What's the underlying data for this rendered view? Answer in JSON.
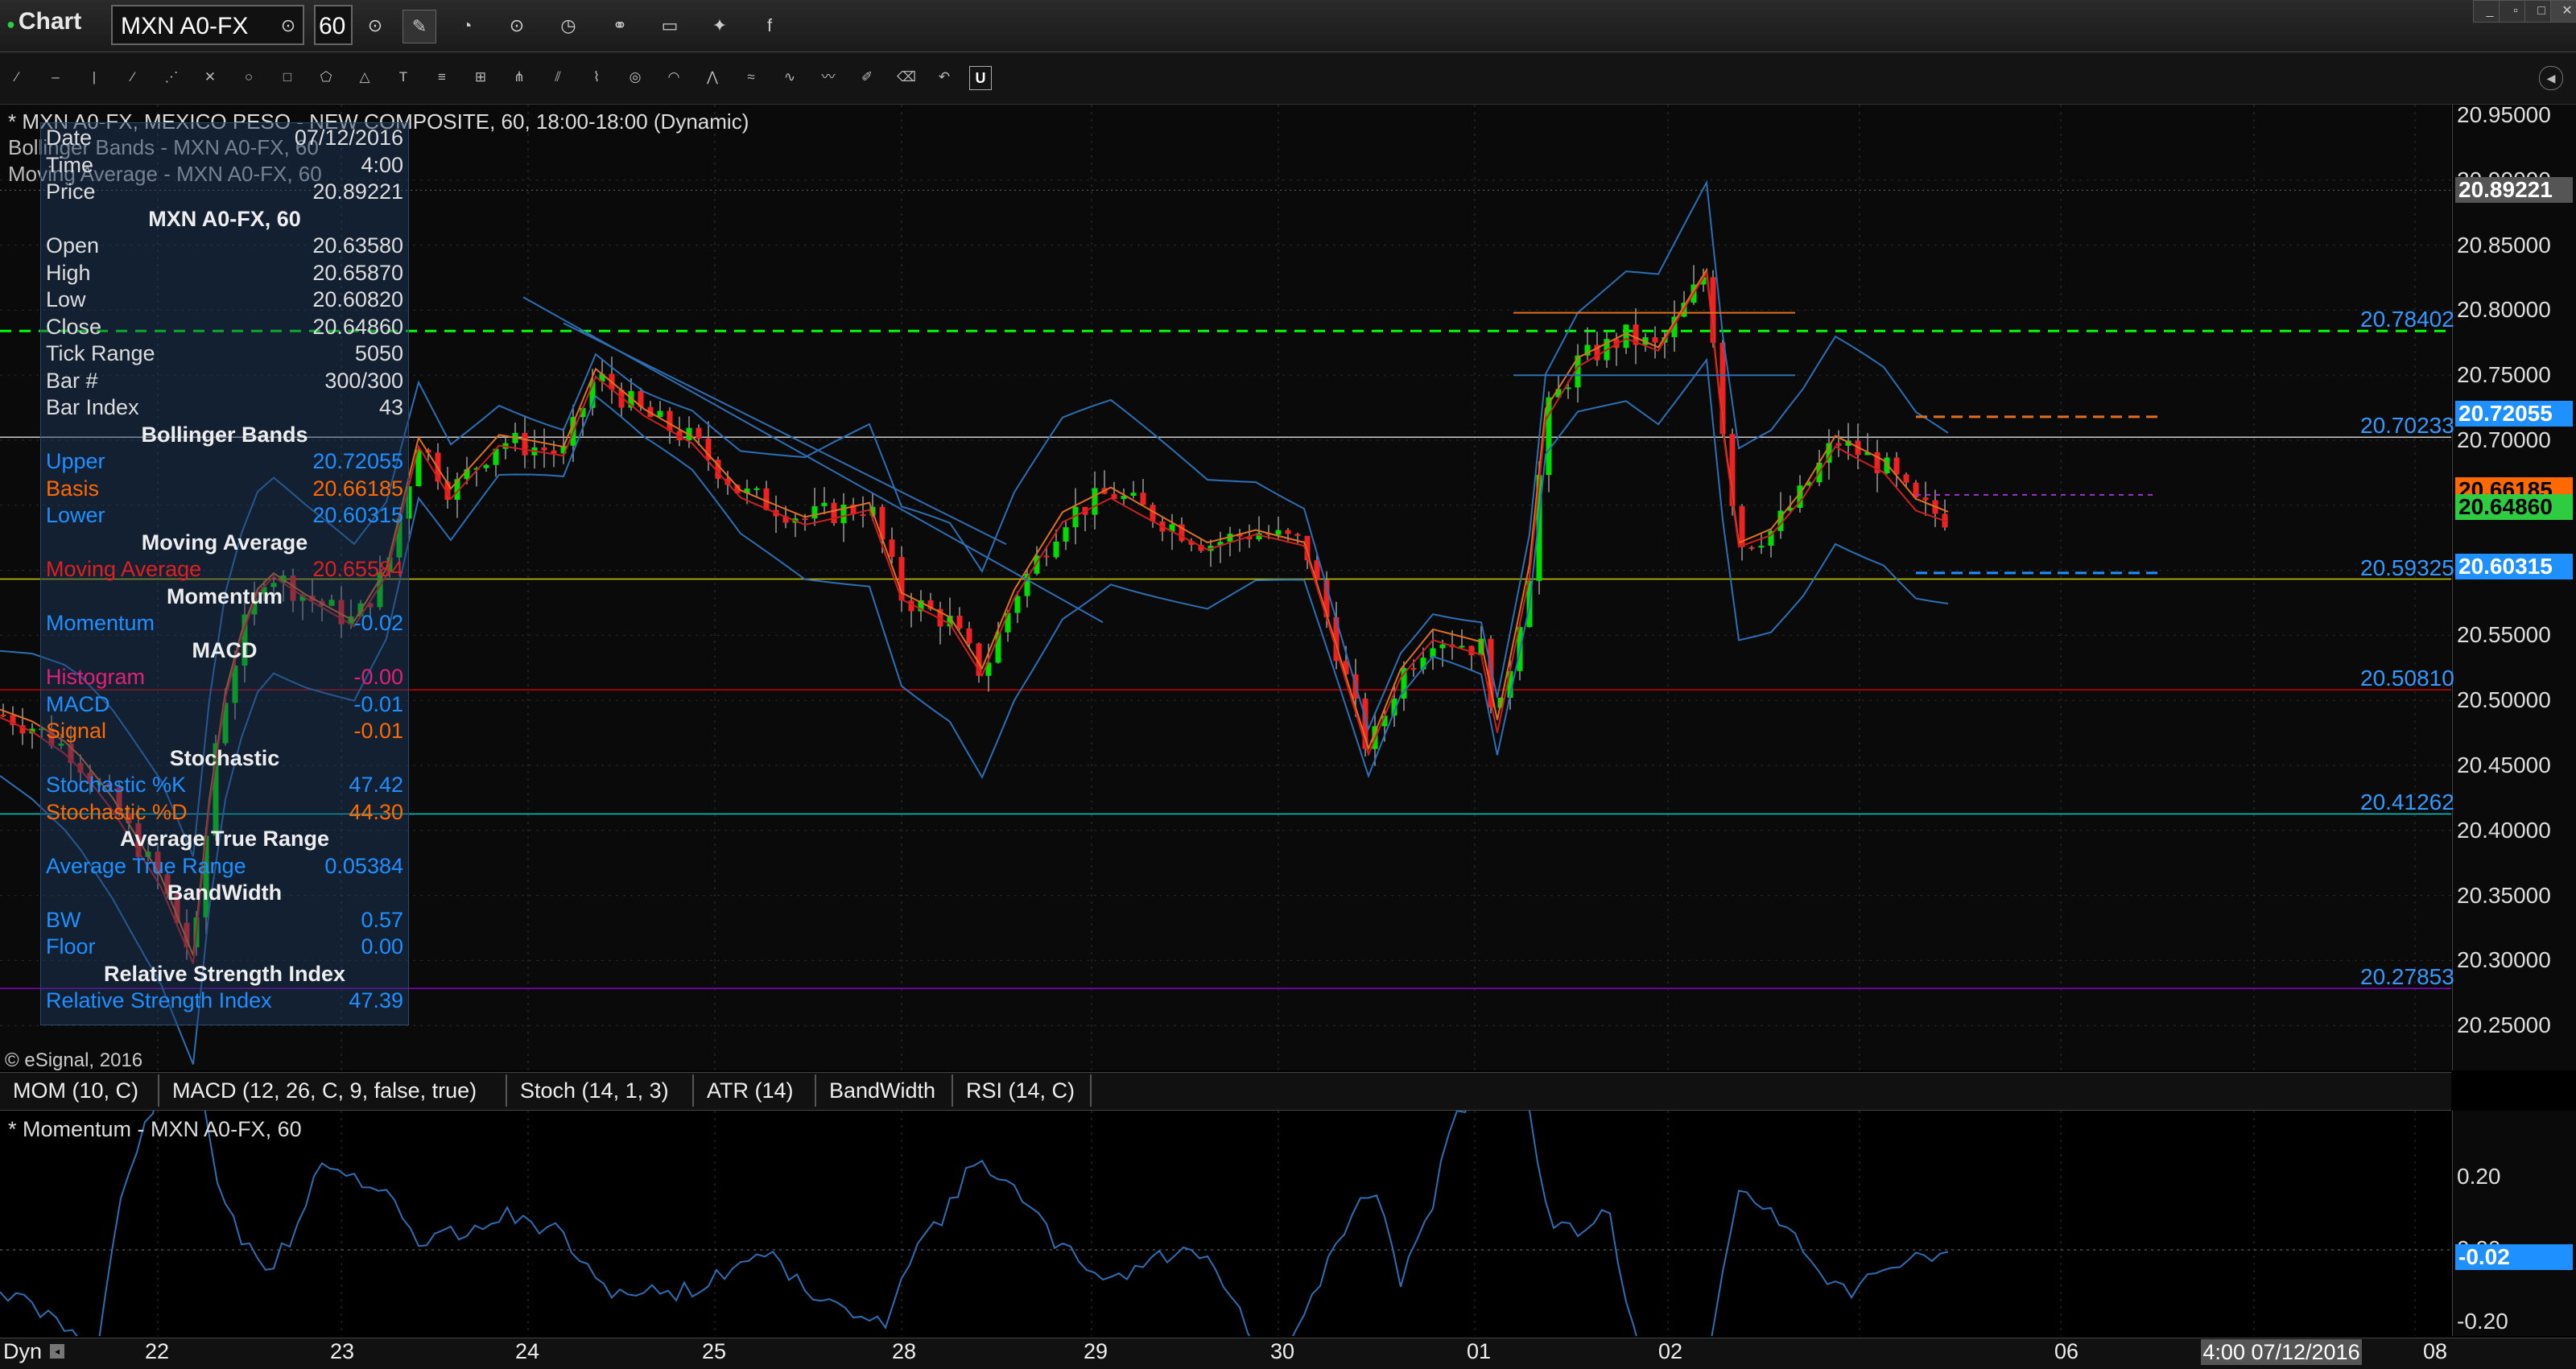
{
  "window": {
    "title": "Chart",
    "symbol": "MXN A0-FX",
    "interval": "60",
    "controls": [
      "minimize-icon",
      "restore-icon",
      "maximize-icon",
      "close-icon"
    ]
  },
  "toolbar": {
    "top_icons": [
      "symbol-link-icon",
      "interval-link-icon",
      "pencil-icon",
      "cursor-icon",
      "crosshair-icon",
      "clock-icon",
      "link-icon",
      "chat-icon",
      "twitter-icon",
      "facebook-icon"
    ],
    "tools": [
      "line",
      "trend-line",
      "vertical-line",
      "horizontal-line",
      "arrow",
      "cross",
      "ellipse",
      "rectangle",
      "polygon",
      "triangle",
      "text",
      "fibonacci",
      "gann",
      "pitchfork",
      "channel",
      "regression",
      "cycles",
      "arc",
      "fan",
      "speed",
      "elliott",
      "wave",
      "brush",
      "eraser",
      "undo"
    ]
  },
  "chart": {
    "caption": "* MXN A0-FX, MEXICO PESO - NEW COMPOSITE, 60, 18:00-18:00 (Dynamic)",
    "bb_caption": "Bollinger Bands - MXN A0-FX, 60",
    "ma_caption": "Moving Average - MXN A0-FX, 60",
    "copyright": "© eSignal, 2016",
    "price_axis": [
      "20.95000",
      "20.90000",
      "20.85000",
      "20.80000",
      "20.75000",
      "20.70000",
      "20.65000",
      "20.60000",
      "20.55000",
      "20.50000",
      "20.45000",
      "20.40000",
      "20.35000",
      "20.30000",
      "20.25000"
    ],
    "price_tags": [
      {
        "value": "20.89221",
        "color": "#555555"
      },
      {
        "value": "20.72055",
        "color": "#1e90ff"
      },
      {
        "value": "20.66185",
        "color": "#ff6a00"
      },
      {
        "value": "20.64860",
        "color": "#2ecc40"
      },
      {
        "value": "20.60315",
        "color": "#1e90ff"
      }
    ],
    "levels": [
      {
        "value": "20.78402",
        "color": "#00ff00",
        "style": "dashed"
      },
      {
        "value": "20.70233",
        "color": "#cccccc",
        "style": "solid"
      },
      {
        "value": "20.59325",
        "color": "#cccc00",
        "style": "solid"
      },
      {
        "value": "20.50810",
        "color": "#cc0000",
        "style": "solid"
      },
      {
        "value": "20.41262",
        "color": "#00cccc",
        "style": "solid"
      },
      {
        "value": "20.27853",
        "color": "#8800cc",
        "style": "solid"
      }
    ]
  },
  "data_window": {
    "rows": [
      {
        "k": "Date",
        "v": "07/12/2016",
        "c": "#dddddd"
      },
      {
        "k": "Time",
        "v": "4:00",
        "c": "#dddddd"
      },
      {
        "k": "Price",
        "v": "20.89221",
        "c": "#dddddd"
      }
    ],
    "symbol_head": "MXN A0-FX, 60",
    "ohlc": [
      {
        "k": "Open",
        "v": "20.63580",
        "c": "#dddddd"
      },
      {
        "k": "High",
        "v": "20.65870",
        "c": "#dddddd"
      },
      {
        "k": "Low",
        "v": "20.60820",
        "c": "#dddddd"
      },
      {
        "k": "Close",
        "v": "20.64860",
        "c": "#dddddd"
      },
      {
        "k": "Tick Range",
        "v": "5050",
        "c": "#dddddd"
      },
      {
        "k": "Bar #",
        "v": "300/300",
        "c": "#dddddd"
      },
      {
        "k": "Bar Index",
        "v": "43",
        "c": "#dddddd"
      }
    ],
    "bb_head": "Bollinger Bands",
    "bb": [
      {
        "k": "Upper",
        "v": "20.72055",
        "c": "#1e90ff"
      },
      {
        "k": "Basis",
        "v": "20.66185",
        "c": "#ff6a00"
      },
      {
        "k": "Lower",
        "v": "20.60315",
        "c": "#1e90ff"
      }
    ],
    "ma_head": "Moving Average",
    "ma": [
      {
        "k": "Moving Average",
        "v": "20.65584",
        "c": "#e02020"
      }
    ],
    "mom_head": "Momentum",
    "mom": [
      {
        "k": "Momentum",
        "v": "-0.02",
        "c": "#1e90ff"
      }
    ],
    "macd_head": "MACD",
    "macd": [
      {
        "k": "Histogram",
        "v": "-0.00",
        "c": "#e0207a"
      },
      {
        "k": "MACD",
        "v": "-0.01",
        "c": "#1e90ff"
      },
      {
        "k": "Signal",
        "v": "-0.01",
        "c": "#ff6a00"
      }
    ],
    "stoch_head": "Stochastic",
    "stoch": [
      {
        "k": "Stochastic %K",
        "v": "47.42",
        "c": "#1e90ff"
      },
      {
        "k": "Stochastic %D",
        "v": "44.30",
        "c": "#ff6a00"
      }
    ],
    "atr_head": "Average True Range",
    "atr": [
      {
        "k": "Average True Range",
        "v": "0.05384",
        "c": "#1e90ff"
      }
    ],
    "bw_head": "BandWidth",
    "bw": [
      {
        "k": "BW",
        "v": "0.57",
        "c": "#1e90ff"
      },
      {
        "k": "Floor",
        "v": "0.00",
        "c": "#1e90ff"
      }
    ],
    "rsi_head": "Relative Strength Index",
    "rsi": [
      {
        "k": "Relative Strength Index",
        "v": "47.39",
        "c": "#1e90ff"
      }
    ]
  },
  "indicator_tabs": [
    "MOM (10, C)",
    "MACD (12, 26, C, 9, false, true)",
    "Stoch (14, 1, 3)",
    "ATR (14)",
    "BandWidth",
    "RSI (14, C)"
  ],
  "momentum_pane": {
    "title": "* Momentum - MXN A0-FX, 60",
    "axis": [
      "0.20",
      "0.00",
      "-0.20"
    ],
    "current_tag": "-0.02"
  },
  "time_axis": {
    "left_label": "Dyn",
    "labels": [
      "22",
      "23",
      "24",
      "25",
      "28",
      "29",
      "30",
      "01",
      "02",
      "06",
      "08"
    ],
    "cursor_time": "4:00 07/12/2016"
  }
}
